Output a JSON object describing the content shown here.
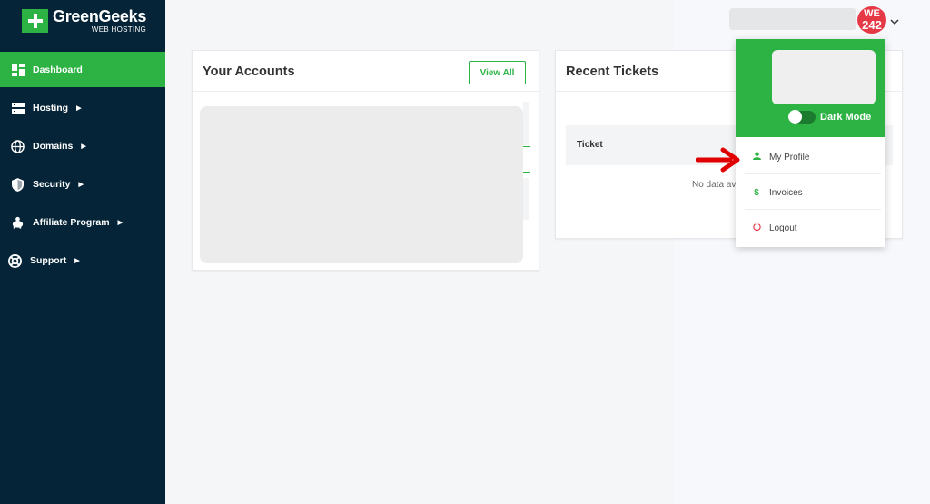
{
  "brand": {
    "name": "GreenGeeks",
    "sub": "WEB HOSTING"
  },
  "nav": [
    {
      "label": "Dashboard",
      "icon": "dashboard-icon",
      "active": true,
      "caret": false
    },
    {
      "label": "Hosting",
      "icon": "server-icon",
      "active": false,
      "caret": true
    },
    {
      "label": "Domains",
      "icon": "globe-icon",
      "active": false,
      "caret": true
    },
    {
      "label": "Security",
      "icon": "shield-icon",
      "active": false,
      "caret": true
    },
    {
      "label": "Affiliate Program",
      "icon": "piggy-bank-icon",
      "active": false,
      "caret": true
    },
    {
      "label": "Support",
      "icon": "lifebuoy-icon",
      "active": false,
      "caret": true
    }
  ],
  "header": {
    "avatar_top": "WE",
    "avatar_bottom": "242"
  },
  "accounts": {
    "title": "Your Accounts",
    "view_all": "View All"
  },
  "tickets": {
    "title": "Recent Tickets",
    "column": "Ticket",
    "empty": "No data av"
  },
  "dropdown": {
    "dark_mode": "Dark Mode",
    "items": [
      {
        "label": "My Profile",
        "icon": "user-icon",
        "color": "#2db344"
      },
      {
        "label": "Invoices",
        "icon": "dollar-icon",
        "color": "#2db344"
      },
      {
        "label": "Logout",
        "icon": "power-icon",
        "color": "#e63946"
      }
    ]
  },
  "colors": {
    "brand": "#2db344",
    "sidebar": "#052437",
    "annotation": "#e00000"
  }
}
